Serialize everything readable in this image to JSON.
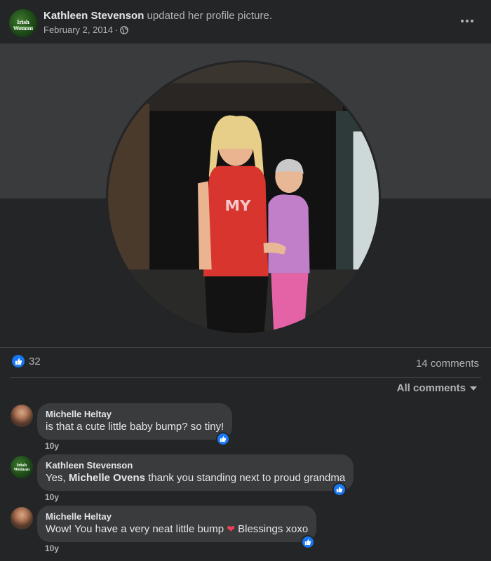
{
  "post": {
    "author": "Kathleen Stevenson",
    "action": " updated her profile picture.",
    "date": "February 2, 2014",
    "separator": "·",
    "avatar_logo_text": "Irish Woman"
  },
  "stats": {
    "like_count": "32",
    "comment_count": "14 comments"
  },
  "filter": {
    "label": "All comments"
  },
  "comments": [
    {
      "name": "Michelle Heltay",
      "text": "is that a cute little baby bump? so tiny!",
      "time": "10y"
    },
    {
      "name": "Kathleen Stevenson",
      "mention": "Michelle Ovens",
      "text_prefix": "Yes, ",
      "text_suffix": " thank you standing next to proud grandma",
      "time": "10y",
      "avatar_logo_text": "Irish Woman"
    },
    {
      "name": "Michelle Heltay",
      "text_before_emoji": "Wow! You have a very neat little bump ",
      "text_after_emoji": " Blessings xoxo",
      "time": "10y"
    }
  ],
  "colors": {
    "background": "#242526",
    "cover": "#3a3b3c",
    "bubble": "#3a3b3c",
    "like_blue": "#1877f2",
    "heart": "#f33e58"
  },
  "icons": [
    "globe-icon",
    "more-icon",
    "like-icon",
    "caret-down-icon",
    "heart-icon"
  ]
}
